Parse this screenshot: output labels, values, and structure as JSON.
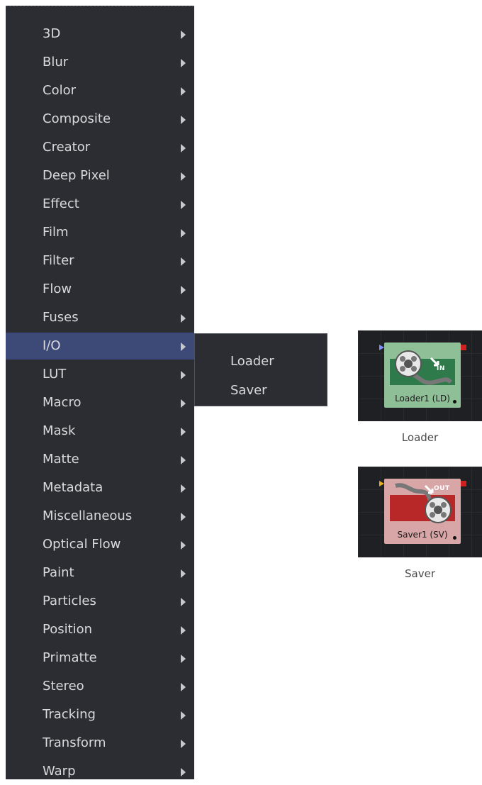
{
  "menu": {
    "items": [
      {
        "label": "3D"
      },
      {
        "label": "Blur"
      },
      {
        "label": "Color"
      },
      {
        "label": "Composite"
      },
      {
        "label": "Creator"
      },
      {
        "label": "Deep Pixel"
      },
      {
        "label": "Effect"
      },
      {
        "label": "Film"
      },
      {
        "label": "Filter"
      },
      {
        "label": "Flow"
      },
      {
        "label": "Fuses"
      },
      {
        "label": "I/O"
      },
      {
        "label": "LUT"
      },
      {
        "label": "Macro"
      },
      {
        "label": "Mask"
      },
      {
        "label": "Matte"
      },
      {
        "label": "Metadata"
      },
      {
        "label": "Miscellaneous"
      },
      {
        "label": "Optical Flow"
      },
      {
        "label": "Paint"
      },
      {
        "label": "Particles"
      },
      {
        "label": "Position"
      },
      {
        "label": "Primatte"
      },
      {
        "label": "Stereo"
      },
      {
        "label": "Tracking"
      },
      {
        "label": "Transform"
      },
      {
        "label": "Warp"
      }
    ],
    "selected_label": "I/O"
  },
  "submenu": {
    "items": [
      {
        "label": "Loader"
      },
      {
        "label": "Saver"
      }
    ]
  },
  "nodes": [
    {
      "node_label": "Loader1  (LD)",
      "badge": "IN",
      "caption": "Loader",
      "colors": {
        "body": "#8fbf97",
        "band": "#2e7a4a",
        "input_pin": "#7f8fff"
      }
    },
    {
      "node_label": "Saver1  (SV)",
      "badge": "OUT",
      "caption": "Saver",
      "colors": {
        "body": "#d8a6a6",
        "band": "#b82828",
        "input_pin": "#e8b020"
      }
    }
  ],
  "colors": {
    "menu_background": "#2b2d33",
    "menu_selected": "#3d4a78",
    "menu_text": "#d9dadc",
    "output_pin": "#d02020"
  }
}
